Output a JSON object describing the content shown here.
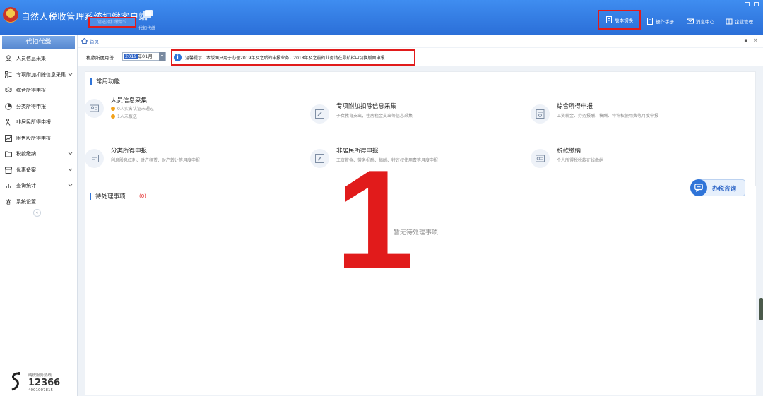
{
  "header": {
    "title": "自然人税收管理系统扣缴客户端",
    "account_selector": "请选择扣缴单位",
    "switch_label": "代扣代缴",
    "nav": {
      "version_switch": "版本切换",
      "manual": "操作手册",
      "messages": "消息中心",
      "enterprise": "企业管理"
    }
  },
  "sidebar": {
    "header": "代扣代缴",
    "items": [
      {
        "label": "人员信息采集"
      },
      {
        "label": "专项附加扣除信息采集"
      },
      {
        "label": "综合所得申报"
      },
      {
        "label": "分类所得申报"
      },
      {
        "label": "非居民所得申报"
      },
      {
        "label": "限售股所得申报"
      },
      {
        "label": "税款缴纳"
      },
      {
        "label": "优惠备案"
      },
      {
        "label": "查询统计"
      },
      {
        "label": "系统设置"
      }
    ],
    "collapse": "«",
    "hotline": {
      "caption": "纳税服务热线",
      "number": "12366",
      "sub": "4001007815"
    }
  },
  "tabs": {
    "home": "首页"
  },
  "period": {
    "label": "税款所属月份",
    "year": "2019",
    "month": "年01月"
  },
  "notice": {
    "icon": "i",
    "text": "温馨提示：本版面只用于办理2019年及之后的申报业务，2018年及之前的业务请在导航栏中切换版面申报"
  },
  "functions": {
    "title": "常用功能",
    "person": {
      "name": "人员信息采集",
      "status1": "0人实名认证未通过",
      "status2": "1人未报送"
    },
    "special": {
      "name": "专项附加扣除信息采集",
      "desc": "子女教育支出，住房租金支出等信息采集"
    },
    "comprehensive": {
      "name": "综合所得申报",
      "desc": "工资薪金、劳务报酬、稿酬、特许权使用费等月度申报"
    },
    "classified": {
      "name": "分类所得申报",
      "desc": "利息股息红利、财产租赁、财产转让等月度申报"
    },
    "nonresident": {
      "name": "非居民所得申报",
      "desc": "工资薪金、劳务报酬、稿酬、特许权使用费等月度申报"
    },
    "payment": {
      "name": "税款缴纳",
      "desc": "个人所得税税款在线缴纳"
    }
  },
  "pending": {
    "title": "待处理事项",
    "count": "(0)",
    "empty": "暂无待处理事项"
  },
  "consult": {
    "label": "办税咨询"
  },
  "annotation": {
    "big_number": "1",
    "color": "#e11b1b"
  }
}
